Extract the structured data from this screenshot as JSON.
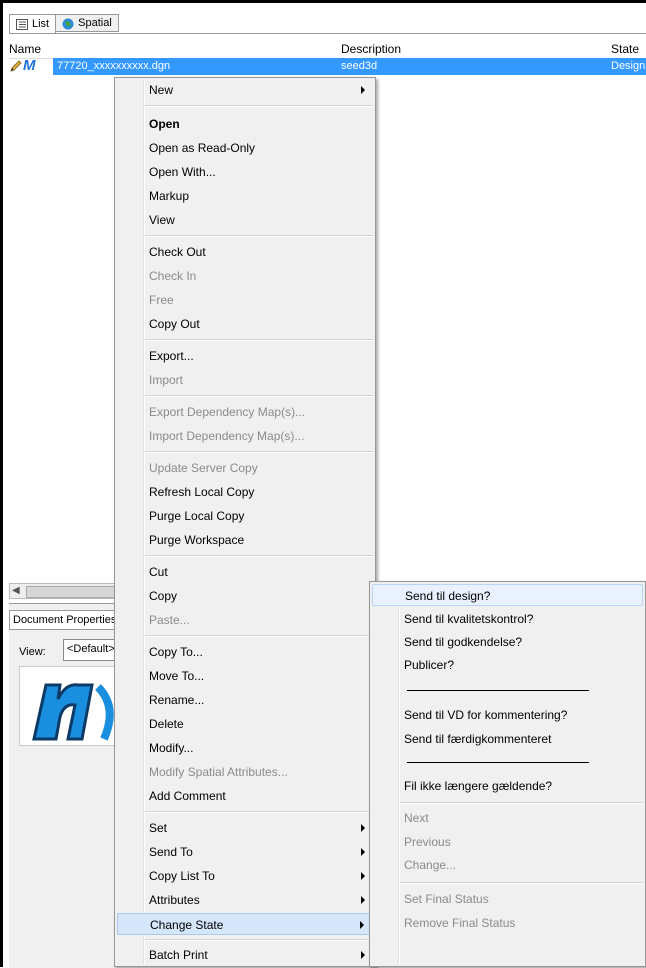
{
  "tabs": [
    {
      "label": "List",
      "icon": "list-icon"
    },
    {
      "label": "Spatial",
      "icon": "globe-icon"
    }
  ],
  "columns": {
    "name": "Name",
    "description": "Description",
    "state": "State"
  },
  "row": {
    "name": "77720_xxxxxxxxxx.dgn",
    "description": "seed3d",
    "state": "Design"
  },
  "lower_panel": {
    "tab": "Document Properties",
    "view_label": "View:",
    "view_value": "<Default>"
  },
  "context_menu": {
    "items": [
      {
        "label": "New",
        "submenu": true
      },
      {
        "label": "Open",
        "bold": true
      },
      {
        "label": "Open as Read-Only"
      },
      {
        "label": "Open With..."
      },
      {
        "label": "Markup"
      },
      {
        "label": "View"
      },
      {
        "label": "Check Out"
      },
      {
        "label": "Check In",
        "disabled": true
      },
      {
        "label": "Free",
        "disabled": true
      },
      {
        "label": "Copy Out"
      },
      {
        "label": "Export..."
      },
      {
        "label": "Import",
        "disabled": true
      },
      {
        "label": "Export Dependency Map(s)...",
        "disabled": true
      },
      {
        "label": "Import Dependency Map(s)...",
        "disabled": true
      },
      {
        "label": "Update Server Copy",
        "disabled": true
      },
      {
        "label": "Refresh Local Copy"
      },
      {
        "label": "Purge Local Copy"
      },
      {
        "label": "Purge Workspace"
      },
      {
        "label": "Cut"
      },
      {
        "label": "Copy"
      },
      {
        "label": "Paste...",
        "disabled": true
      },
      {
        "label": "Copy To..."
      },
      {
        "label": "Move To..."
      },
      {
        "label": "Rename..."
      },
      {
        "label": "Delete"
      },
      {
        "label": "Modify..."
      },
      {
        "label": "Modify Spatial Attributes...",
        "disabled": true
      },
      {
        "label": "Add Comment"
      },
      {
        "label": "Set",
        "submenu": true
      },
      {
        "label": "Send To",
        "submenu": true
      },
      {
        "label": "Copy List To",
        "submenu": true
      },
      {
        "label": "Attributes",
        "submenu": true
      },
      {
        "label": "Change State",
        "submenu": true,
        "highlighted": true
      },
      {
        "label": "Batch Print",
        "submenu": true
      }
    ]
  },
  "state_submenu": {
    "items": [
      {
        "label": "Send til design?",
        "highlighted": true
      },
      {
        "label": "Send til kvalitetskontrol?"
      },
      {
        "label": "Send til godkendelse?"
      },
      {
        "label": "Publicer?"
      },
      {
        "label": "Send til VD for kommentering?"
      },
      {
        "label": "Send til færdigkommenteret"
      },
      {
        "label": "Fil ikke længere gældende?"
      },
      {
        "label": "Next",
        "disabled": true
      },
      {
        "label": "Previous",
        "disabled": true
      },
      {
        "label": "Change...",
        "disabled": true
      },
      {
        "label": "Set Final Status",
        "disabled": true
      },
      {
        "label": "Remove Final Status",
        "disabled": true
      }
    ]
  }
}
